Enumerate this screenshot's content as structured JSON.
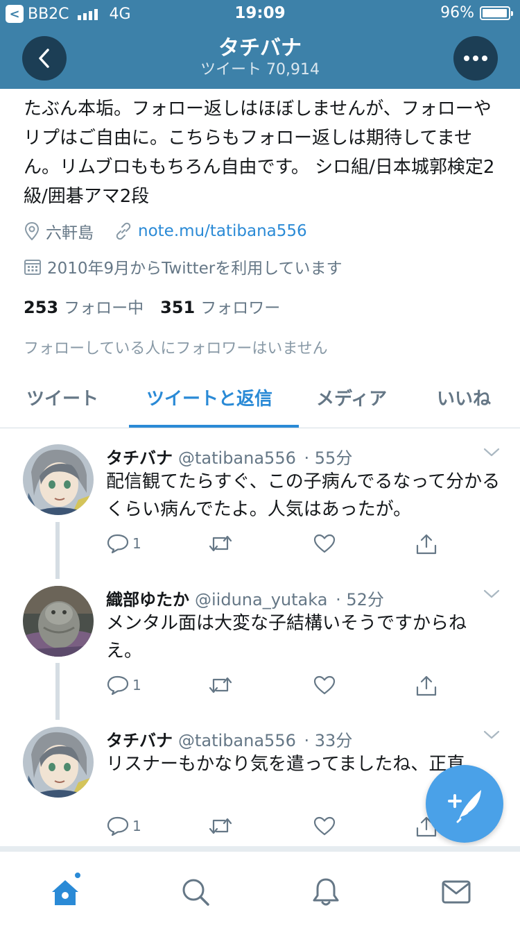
{
  "status_bar": {
    "carrier_badge": "<",
    "carrier": "BB2C",
    "network": "4G",
    "time": "19:09",
    "battery": "96%"
  },
  "header": {
    "name": "タチバナ",
    "tweet_count": "ツイート 70,914",
    "back_icon": "chevron-left-icon",
    "more_icon": "ellipsis-icon"
  },
  "profile": {
    "bio": "たぶん本垢。フォロー返しはほぼしませんが、フォローやリプはご自由に。こちらもフォロー返しは期待してません。リムブロももちろん自由です。 シロ組/日本城郭検定2級/囲碁アマ2段",
    "location": "六軒島",
    "link": "note.mu/tatibana556",
    "joined": "2010年9月からTwitterを利用しています",
    "following_count": "253",
    "following_label": "フォロー中",
    "followers_count": "351",
    "followers_label": "フォロワー",
    "no_mutual": "フォローしている人にフォロワーはいません"
  },
  "tabs": [
    {
      "label": "ツイート",
      "active": false
    },
    {
      "label": "ツイートと返信",
      "active": true
    },
    {
      "label": "メディア",
      "active": false
    },
    {
      "label": "いいね",
      "active": false
    }
  ],
  "tweets": [
    {
      "name": "タチバナ",
      "handle": "@tatibana556",
      "time": "· 55分",
      "text": "配信観てたらすぐ、この子病んでるなって分かるくらい病んでたよ。人気はあったが。",
      "reply_count": "1"
    },
    {
      "name": "織部ゆたか",
      "handle": "@iiduna_yutaka",
      "time": "· 52分",
      "text": "メンタル面は大変な子結構いそうですからねえ。",
      "reply_count": "1"
    },
    {
      "name": "タチバナ",
      "handle": "@tatibana556",
      "time": "· 33分",
      "text": "リスナーもかなり気を遣ってましたね、正直。",
      "reply_count": "1"
    }
  ],
  "colors": {
    "header_bg": "#3d81a9",
    "accent": "#2a8ad6",
    "fab": "#4aa1e8"
  },
  "bottom_nav": [
    "home-icon",
    "search-icon",
    "notifications-icon",
    "messages-icon"
  ]
}
